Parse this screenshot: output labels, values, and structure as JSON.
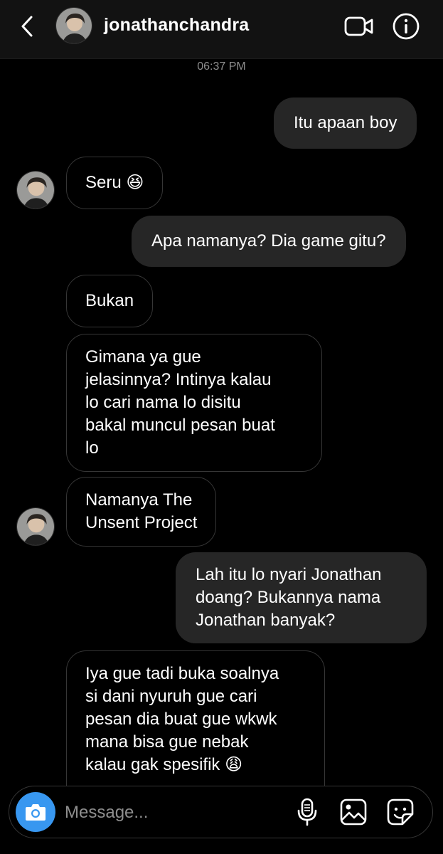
{
  "header": {
    "username": "jonathanchandra",
    "icons": {
      "back": "chevron-left-icon",
      "video": "video-camera-icon",
      "info": "info-icon"
    }
  },
  "thread": {
    "timestamp": "06:37 PM",
    "messages": [
      {
        "side": "sent",
        "text": "Itu apaan boy"
      },
      {
        "side": "received",
        "text": "Seru 😆",
        "avatar": true
      },
      {
        "side": "sent",
        "text": "Apa namanya? Dia game gitu?"
      },
      {
        "side": "received",
        "text": "Bukan"
      },
      {
        "side": "received",
        "text": "Gimana ya gue\njelasinnya? Intinya kalau\nlo cari nama lo disitu\nbakal muncul pesan buat\nlo"
      },
      {
        "side": "received",
        "text": "Namanya The\nUnsent Project",
        "avatar": true
      },
      {
        "side": "sent",
        "text": "Lah itu lo nyari Jonathan\ndoang? Bukannya nama\nJonathan banyak?"
      },
      {
        "side": "received",
        "text": "Iya gue tadi buka soalnya\nsi dani nyuruh gue cari\npesan dia buat gue wkwk\nmana bisa gue nebak\nkalau gak spesifik 😩"
      }
    ]
  },
  "composer": {
    "placeholder": "Message...",
    "icons": [
      "camera-icon",
      "microphone-icon",
      "gallery-icon",
      "sticker-icon"
    ]
  },
  "colors": {
    "background": "#000000",
    "header_bg": "#121212",
    "sent_bubble": "#262626",
    "received_border": "#363636",
    "camera_button": "#3897f0",
    "muted_text": "#8e8e8e"
  }
}
